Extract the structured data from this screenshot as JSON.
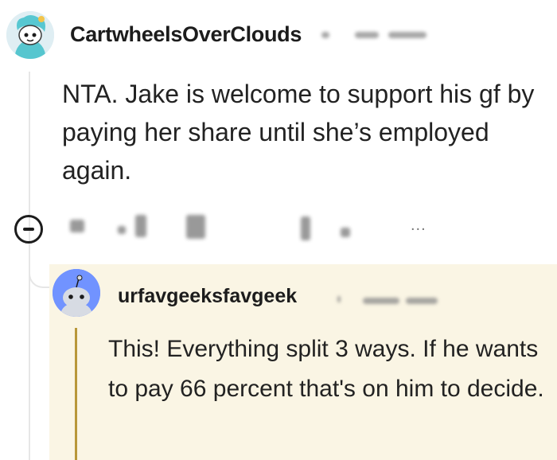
{
  "parent_comment": {
    "username": "CartwheelsOverClouds",
    "avatar": "snoo-avatar-icon",
    "body": "NTA. Jake is welcome to support his gf by paying her share until she’s employed again."
  },
  "actions": {
    "collapse_icon": "collapse-minus-icon",
    "more_label": "..."
  },
  "reply_comment": {
    "username": "urfavgeeksfavgeek",
    "avatar": "default-snoo-avatar-icon",
    "body": "This! Everything split 3 ways. If he wants to pay 66 percent that's on him to decide.",
    "highlight_color": "#faf5e4",
    "bar_color": "#b8973a"
  }
}
